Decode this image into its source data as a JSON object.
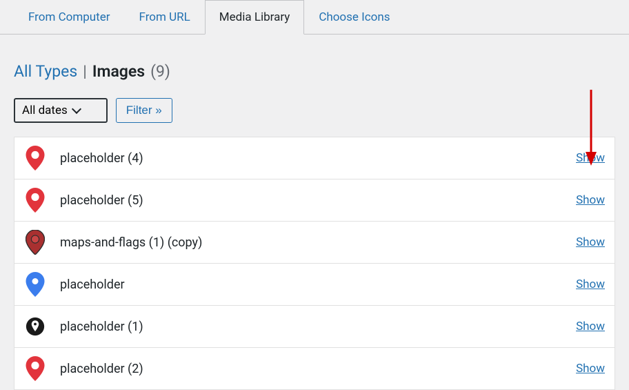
{
  "tabs": [
    {
      "label": "From Computer",
      "active": false
    },
    {
      "label": "From URL",
      "active": false
    },
    {
      "label": "Media Library",
      "active": true
    },
    {
      "label": "Choose Icons",
      "active": false
    }
  ],
  "header": {
    "all_types": "All Types",
    "divider": "|",
    "images_label": "Images",
    "count": "(9)"
  },
  "filters": {
    "date_select": "All dates",
    "filter_button": "Filter »"
  },
  "items": [
    {
      "name": "placeholder (4)",
      "icon": "pin-red-open",
      "action": "Show"
    },
    {
      "name": "placeholder (5)",
      "icon": "pin-red-open",
      "action": "Show"
    },
    {
      "name": "maps-and-flags (1) (copy)",
      "icon": "pin-red-outline",
      "action": "Show"
    },
    {
      "name": "placeholder",
      "icon": "pin-blue",
      "action": "Show"
    },
    {
      "name": "placeholder (1)",
      "icon": "pin-black-circle",
      "action": "Show"
    },
    {
      "name": "placeholder (2)",
      "icon": "pin-red-open",
      "action": "Show"
    }
  ]
}
